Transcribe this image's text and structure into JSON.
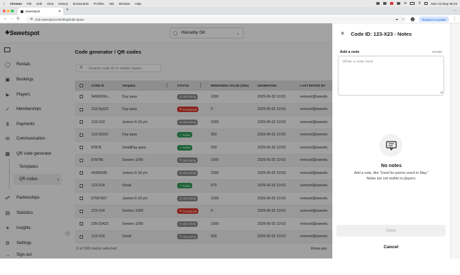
{
  "menubar": {
    "app": "Chrome",
    "items": [
      "File",
      "Edit",
      "View",
      "History",
      "Bookmarks",
      "Profiles",
      "Tab",
      "Window",
      "Help"
    ],
    "clock": "Mon 23 May 08:23"
  },
  "browser": {
    "tab_title": "Sweetspot",
    "url": "club.sweetspot.io/settings/edit-space",
    "relaunch_label": "Relaunch to update"
  },
  "app": {
    "logo_text": "Sweetspot",
    "venue_selector": "Hässelby GK"
  },
  "sidebar": {
    "items": [
      {
        "label": "Rentals",
        "icon": "racket-icon"
      },
      {
        "label": "Bookings",
        "icon": "inbox-icon"
      },
      {
        "label": "Players",
        "icon": "users-icon"
      },
      {
        "label": "Memberships",
        "icon": "badge-check-icon"
      },
      {
        "label": "Payments",
        "icon": "dollar-icon"
      },
      {
        "label": "Communication",
        "icon": "megaphone-icon"
      },
      {
        "label": "QR code generator",
        "icon": "grid-icon"
      },
      {
        "label": "Templates",
        "icon": ""
      },
      {
        "label": "QR codes",
        "icon": "chevron-right-icon"
      },
      {
        "label": "Partnerships",
        "icon": "handshake-icon"
      },
      {
        "label": "Statistics",
        "icon": "chart-icon"
      },
      {
        "label": "Insights",
        "icon": "bulb-icon"
      },
      {
        "label": "Settings",
        "icon": "gear-icon"
      },
      {
        "label": "Sign out",
        "icon": "logout-icon"
      }
    ]
  },
  "page": {
    "title": "Code generator / QR codes",
    "search_placeholder": "Search code ID or holder name",
    "footer_selected": "0 of 100 row(s) selected",
    "footer_rows": "Rows per"
  },
  "table": {
    "columns": [
      "CODE ID",
      "Template",
      "STATUS",
      "REMAINING VALUE (SEK)",
      "GENERATED",
      "LAST EDITED BY"
    ],
    "rows": [
      {
        "code": "54565634...",
        "template": "Day pass",
        "status": "Upcoming",
        "value": "1000",
        "generated": "2025-06-02 10:53",
        "editor": "vemund@sweets"
      },
      {
        "code": "123-2g323",
        "template": "Day pass",
        "status": "Consumed",
        "value": "0",
        "generated": "2025-06-02 10:53",
        "editor": "vemund@sweets"
      },
      {
        "code": "123-X23",
        "template": "Juniors 6-10 y/o",
        "status": "Upcoming",
        "value": "1000",
        "generated": "2025-06-02 10:53",
        "editor": "vemund@sweets"
      },
      {
        "code": "123-32332",
        "template": "Day pass",
        "status": "Active",
        "value": "350",
        "generated": "2025-06-02 10:53",
        "editor": "vemund@sweets"
      },
      {
        "code": "87878",
        "template": "SmallDay pass",
        "status": "Active",
        "value": "500",
        "generated": "2025-06-02 10:53",
        "editor": "vemund@sweets"
      },
      {
        "code": "878786",
        "template": "Seniors 1000",
        "status": "Upcoming",
        "value": "1000",
        "generated": "2025-06-02 10:53",
        "editor": "vemund@sweets"
      },
      {
        "code": "64365435",
        "template": "Juniors 6-10 y/o",
        "status": "Upcoming",
        "value": "1000",
        "generated": "2025-06-02 10:53",
        "editor": "vemund@sweets"
      },
      {
        "code": "123-X24",
        "template": "Small",
        "status": "Active",
        "value": "670",
        "generated": "2025-06-02 10:53",
        "editor": "vemund@sweets"
      },
      {
        "code": "87567567",
        "template": "Juniors 6-10 y/o",
        "status": "Upcoming",
        "value": "1000",
        "generated": "2025-06-02 10:53",
        "editor": "vemund@sweets"
      },
      {
        "code": "123-X24",
        "template": "Seniors 1000",
        "status": "Consumed",
        "value": "0",
        "generated": "2025-06-02 10:53",
        "editor": "vemund@sweets"
      },
      {
        "code": "239-23423",
        "template": "Seniors 1000",
        "status": "Upcoming",
        "value": "1000",
        "generated": "2025-06-02 10:53",
        "editor": "vemund@sweets"
      },
      {
        "code": "123-X24",
        "template": "Small",
        "status": "Upcoming",
        "value": "500",
        "generated": "2025-06-02 10:53",
        "editor": "vemund@sweets"
      }
    ]
  },
  "status_colors": {
    "Upcoming": "#8a8a8a",
    "Consumed": "#d9342b",
    "Active": "#2e9b57"
  },
  "panel": {
    "title": "Code ID: 123-X23 - Notes",
    "note_label": "Add a note",
    "counter": "0/1000",
    "placeholder": "Write a note here",
    "empty_title": "No notes",
    "empty_desc": "Add a note, like \"Used for promo event in May.\" Notes are not visible to players.",
    "save_label": "Save",
    "cancel_label": "Cancel"
  }
}
